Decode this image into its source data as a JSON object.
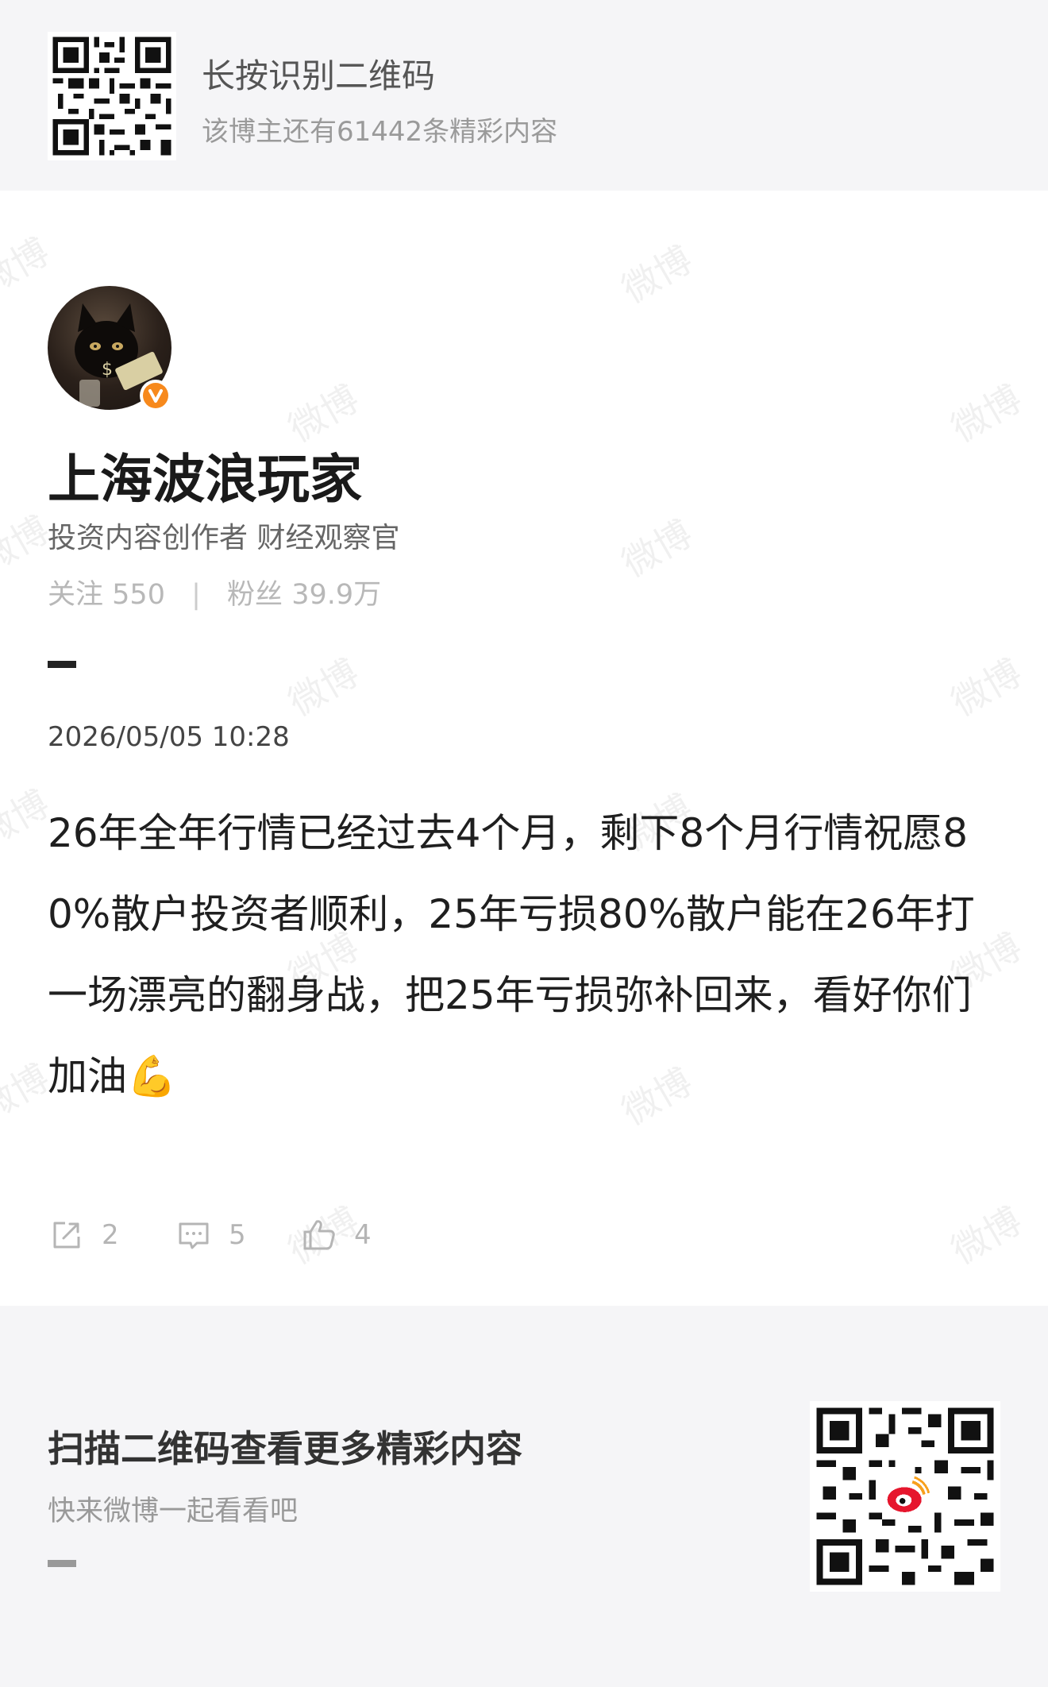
{
  "header": {
    "title": "长按识别二维码",
    "subtitle": "该博主还有61442条精彩内容"
  },
  "profile": {
    "name": "上海波浪玩家",
    "description": "投资内容创作者  财经观察官",
    "follow_label": "关注",
    "follow_count": "550",
    "separator": "|",
    "fans_label": "粉丝",
    "fans_count": "39.9万",
    "verified_color": "#f7891c"
  },
  "post": {
    "time": "2026/05/05 10:28",
    "body": "26年全年行情已经过去4个月，剩下8个月行情祝愿80%散户投资者顺利，25年亏损80%散户能在26年打一场漂亮的翻身战，把25年亏损弥补回来，看好你们加油💪",
    "actions": {
      "repost_icon": "share-icon",
      "repost_count": "2",
      "comment_icon": "comment-icon",
      "comment_count": "5",
      "like_icon": "thumbs-up-icon",
      "like_count": "4"
    }
  },
  "footer": {
    "title": "扫描二维码查看更多精彩内容",
    "subtitle": "快来微博一起看看吧"
  },
  "watermark": "微博",
  "colors": {
    "page_bg": "#ffffff",
    "panel_bg": "#f5f5f7",
    "weibo_red": "#e6162d"
  }
}
